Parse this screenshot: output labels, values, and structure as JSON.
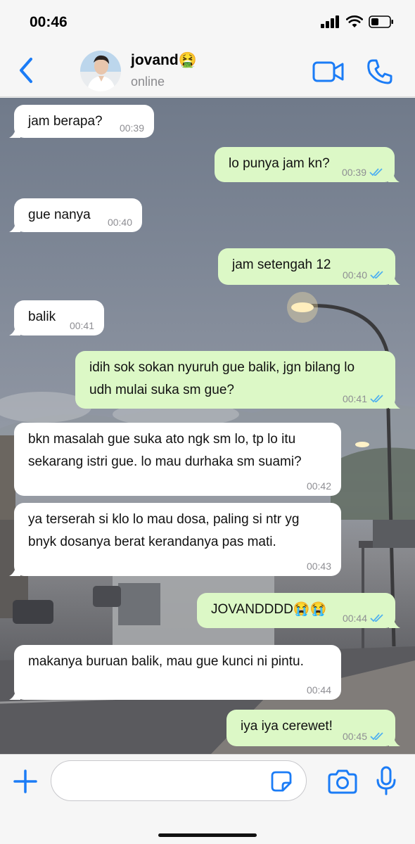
{
  "status_bar": {
    "time": "00:46",
    "icons": [
      "signal-icon",
      "wifi-icon",
      "battery-icon"
    ]
  },
  "header": {
    "contact_name": "jovand🤮",
    "contact_status": "online",
    "icons": [
      "back-chevron-icon",
      "video-camera-icon",
      "phone-icon"
    ],
    "accent_color": "#1b7cf6"
  },
  "messages": [
    {
      "direction": "in",
      "text": "jam berapa?",
      "time": "00:39"
    },
    {
      "direction": "out",
      "text": "lo punya jam kn?",
      "time": "00:39",
      "read": true
    },
    {
      "direction": "in",
      "text": "gue nanya",
      "time": "00:40"
    },
    {
      "direction": "out",
      "text": "jam setengah 12",
      "time": "00:40",
      "read": true
    },
    {
      "direction": "in",
      "text": "balik",
      "time": "00:41"
    },
    {
      "direction": "out",
      "text": "idih sok sokan nyuruh gue balik, jgn bilang lo udh mulai suka sm gue?",
      "time": "00:41",
      "read": true
    },
    {
      "direction": "in",
      "text": "bkn masalah gue suka ato ngk sm lo, tp lo itu sekarang istri gue. lo mau durhaka sm suami?",
      "time": "00:42"
    },
    {
      "direction": "in",
      "text": "ya terserah si klo lo mau dosa, paling si ntr yg bnyk dosanya berat kerandanya pas mati.",
      "time": "00:43"
    },
    {
      "direction": "out",
      "text": "JOVANDDDD😭😭",
      "time": "00:44",
      "read": true
    },
    {
      "direction": "in",
      "text": "makanya buruan balik, mau gue kunci ni pintu.",
      "time": "00:44"
    },
    {
      "direction": "out",
      "text": "iya iya cerewet!",
      "time": "00:45",
      "read": true
    }
  ],
  "input_bar": {
    "placeholder": "",
    "icons": [
      "plus-icon",
      "sticker-icon",
      "camera-icon",
      "microphone-icon"
    ]
  },
  "colors": {
    "incoming_bubble": "#ffffff",
    "outgoing_bubble": "#dcf8c6",
    "read_ticks": "#4fb0f0"
  }
}
